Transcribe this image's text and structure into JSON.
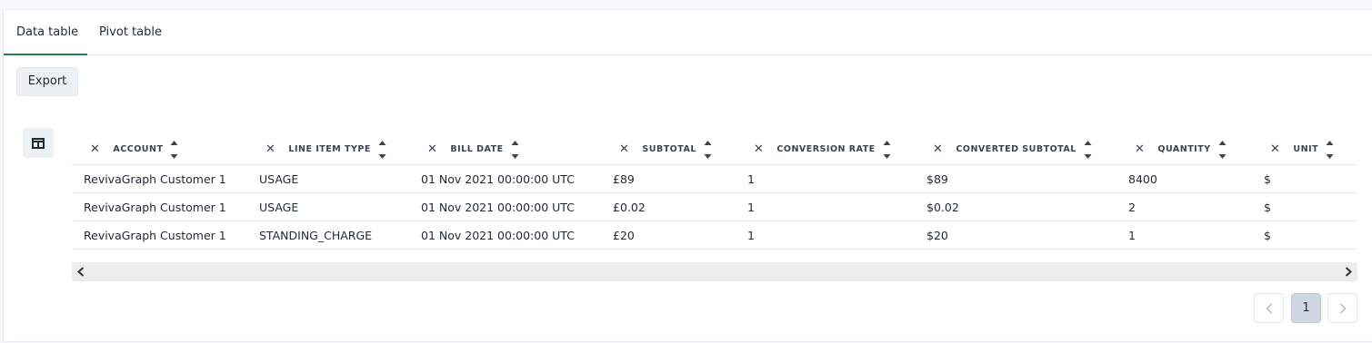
{
  "tabs": [
    {
      "label": "Data table",
      "active": true
    },
    {
      "label": "Pivot table",
      "active": false
    }
  ],
  "toolbar": {
    "export_label": "Export"
  },
  "table": {
    "columns": [
      "ACCOUNT",
      "LINE ITEM TYPE",
      "BILL DATE",
      "SUBTOTAL",
      "CONVERSION RATE",
      "CONVERTED SUBTOTAL",
      "QUANTITY",
      "UNIT"
    ],
    "rows": [
      [
        "RevivaGraph Customer 1",
        "USAGE",
        "01 Nov 2021 00:00:00 UTC",
        "£89",
        "1",
        "$89",
        "8400",
        "$"
      ],
      [
        "RevivaGraph Customer 1",
        "USAGE",
        "01 Nov 2021 00:00:00 UTC",
        "£0.02",
        "1",
        "$0.02",
        "2",
        "$"
      ],
      [
        "RevivaGraph Customer 1",
        "STANDING_CHARGE",
        "01 Nov 2021 00:00:00 UTC",
        "£20",
        "1",
        "$20",
        "1",
        "$"
      ]
    ]
  },
  "pagination": {
    "current_page": "1"
  },
  "colors": {
    "accent_tab": "#2e7d4f",
    "page_selected": "#cfd8e2"
  }
}
